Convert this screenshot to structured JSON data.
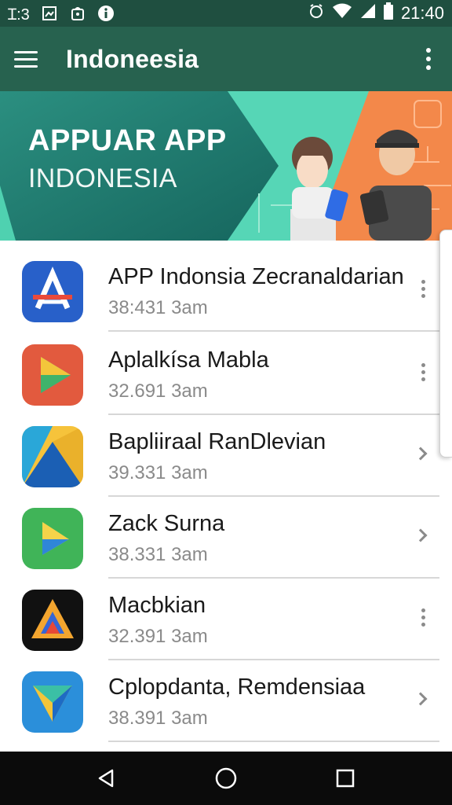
{
  "status_bar": {
    "left_text": "Ɪ:3",
    "time": "21:40",
    "icons": [
      "image-icon",
      "bag-icon",
      "info-icon",
      "alarm-icon",
      "wifi-icon",
      "signal-icon",
      "battery-icon"
    ]
  },
  "app_bar": {
    "title": "Indoneesia",
    "menu_icon": "hamburger-icon",
    "overflow_icon": "more-vert-icon",
    "color": "#27624f"
  },
  "banner": {
    "title": "APPUAR APP",
    "subtitle": "INDONESIA",
    "colors": [
      "#1f7a6e",
      "#4fd1b0",
      "#f3884a"
    ]
  },
  "apps": [
    {
      "name": "APP Indonsia Zecranaldarian",
      "meta": "38:431 3am",
      "icon": "app-store-icon",
      "action": "more"
    },
    {
      "name": "Aplalkísa Mabla",
      "meta": "32.691 3am",
      "icon": "play-icon",
      "action": "more"
    },
    {
      "name": "Bapliiraal RanDlevian",
      "meta": "39.331 3am",
      "icon": "drive-icon",
      "action": "chevron"
    },
    {
      "name": "Zack Surna",
      "meta": "38.331 3am",
      "icon": "play-green-icon",
      "action": "chevron"
    },
    {
      "name": "Macbkian",
      "meta": "32.391 3am",
      "icon": "triangle-icon",
      "action": "more"
    },
    {
      "name": "Cplopdanta, Remdensiaa",
      "meta": "38.391 3am",
      "icon": "arrow-icon",
      "action": "chevron"
    }
  ],
  "nav": {
    "back": "back-icon",
    "home": "home-icon",
    "recents": "recents-icon"
  }
}
